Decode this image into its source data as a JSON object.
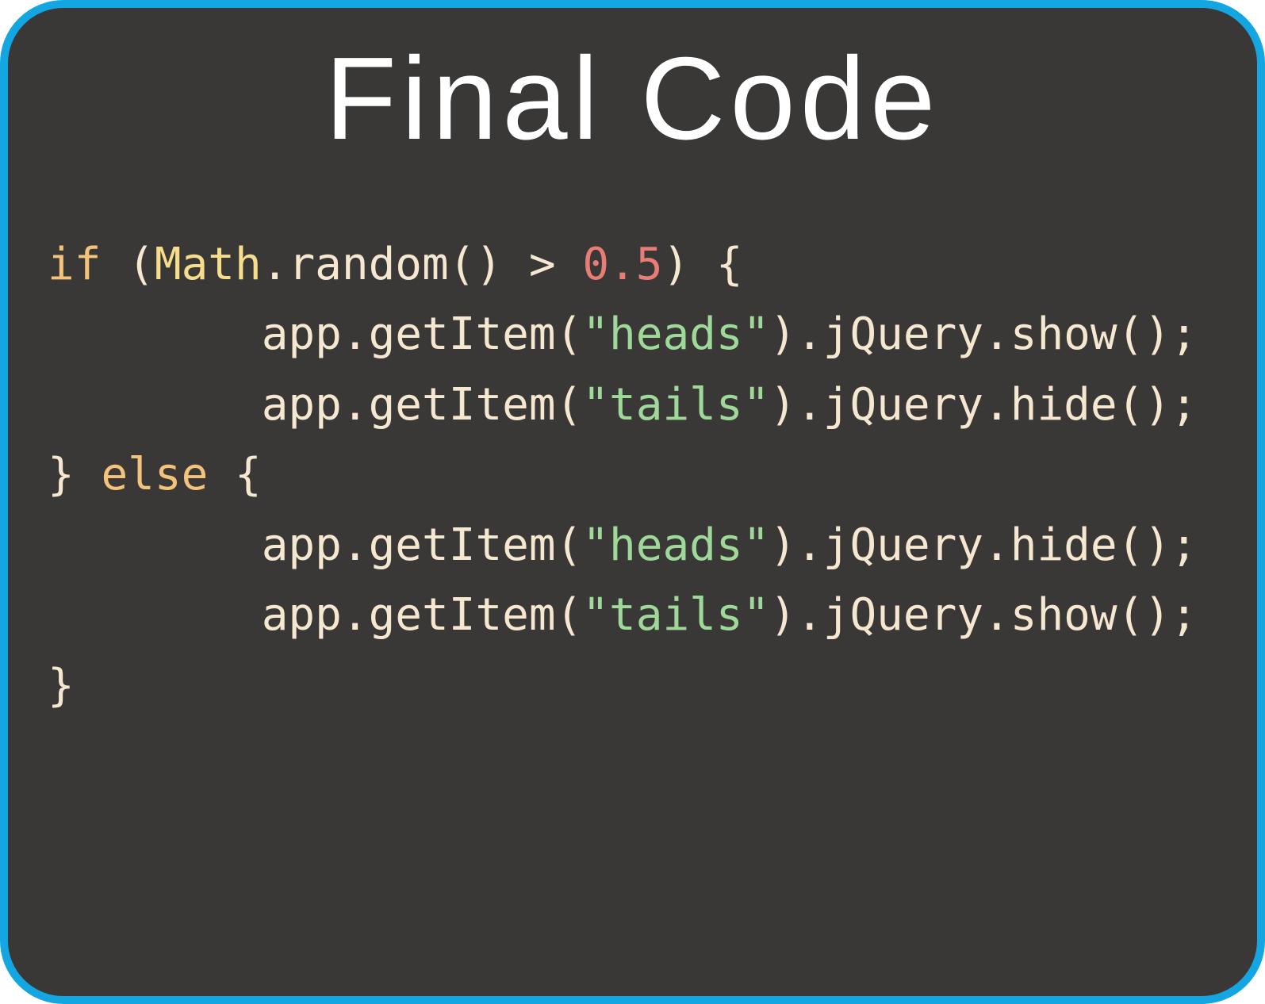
{
  "title": "Final Code",
  "code": {
    "l1": {
      "kw_if": "if",
      "p1": " (",
      "cls": "Math",
      "p2": ".random() > ",
      "num": "0.5",
      "p3": ") {"
    },
    "l2": {
      "indent": "        ",
      "p1": "app.getItem(",
      "str": "\"heads\"",
      "p2": ").jQuery.show();"
    },
    "l3": {
      "indent": "        ",
      "p1": "app.getItem(",
      "str": "\"tails\"",
      "p2": ").jQuery.hide();"
    },
    "l4": {
      "p1": "} ",
      "kw_else": "else",
      "p2": " {"
    },
    "l5": {
      "indent": "        ",
      "p1": "app.getItem(",
      "str": "\"heads\"",
      "p2": ").jQuery.hide();"
    },
    "l6": {
      "indent": "        ",
      "p1": "app.getItem(",
      "str": "\"tails\"",
      "p2": ").jQuery.show();"
    },
    "l7": {
      "p1": "}"
    }
  }
}
